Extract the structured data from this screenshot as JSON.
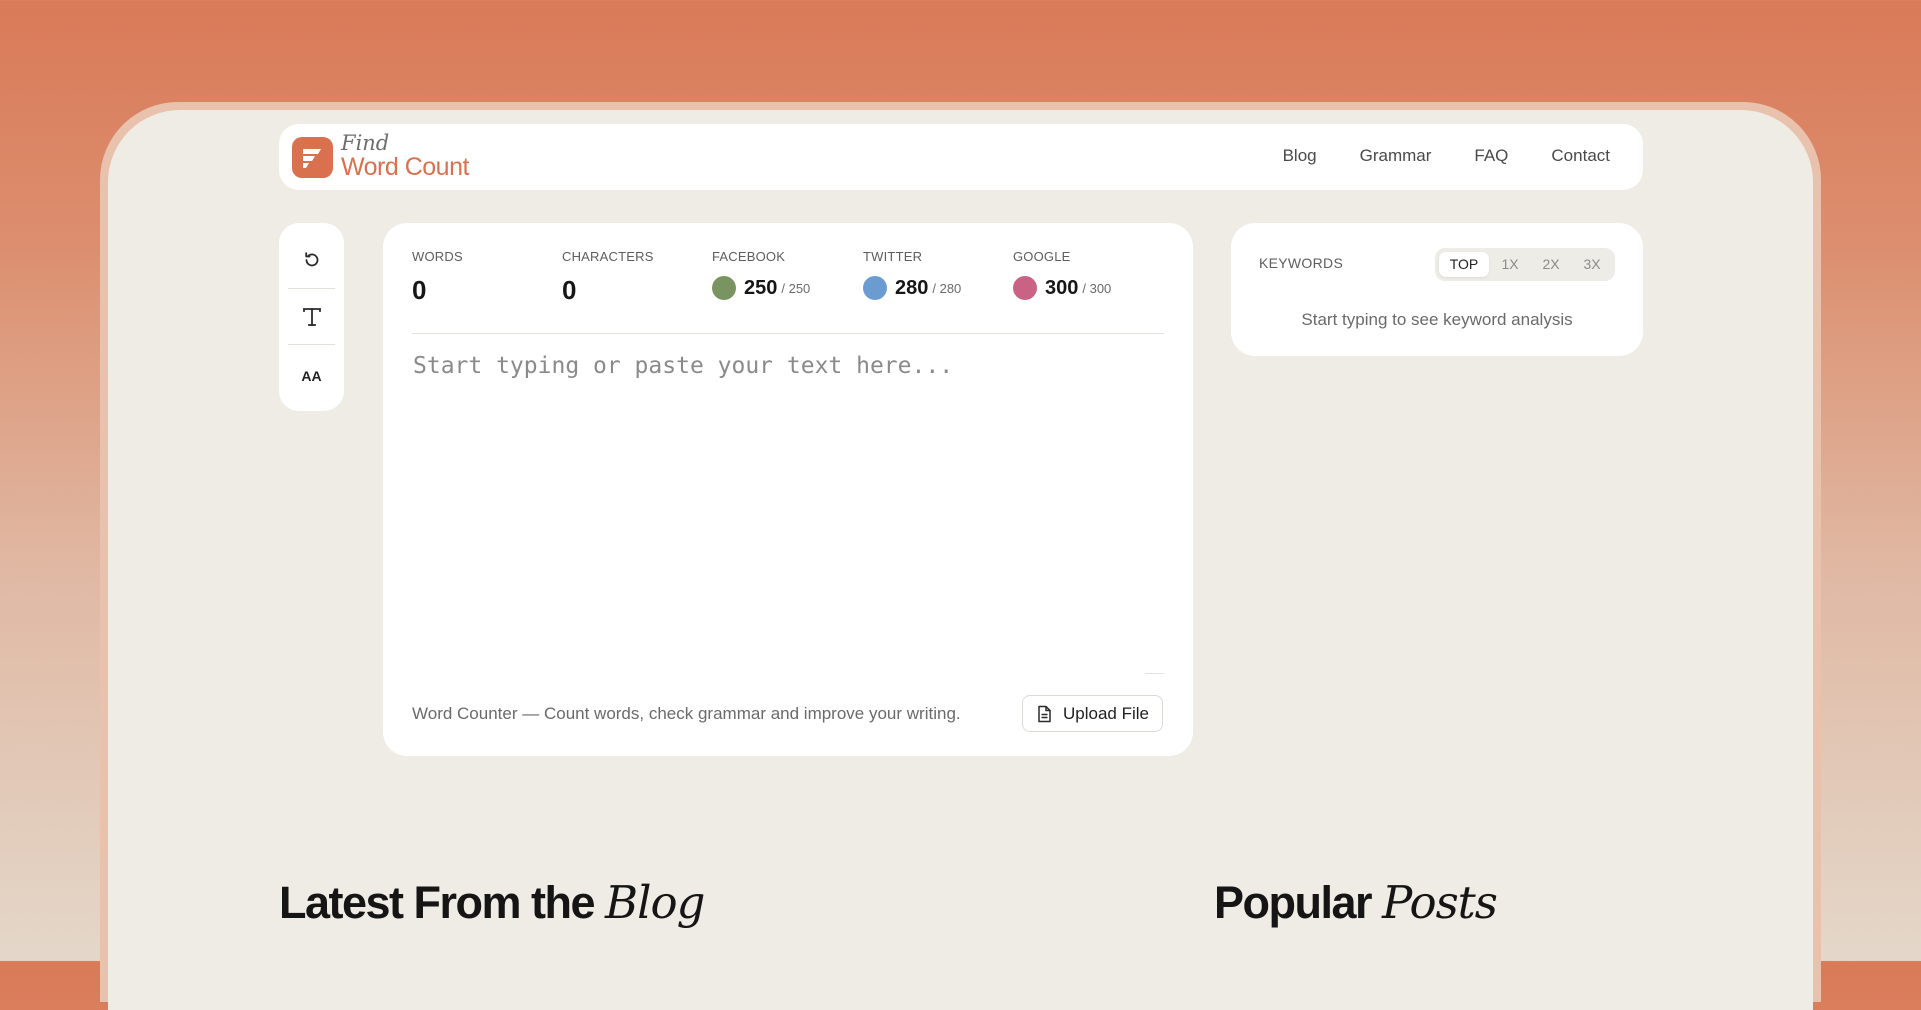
{
  "brand": {
    "logo_top": "Find",
    "logo_bottom": "Word Count",
    "accent_color": "#d9714f"
  },
  "nav": {
    "links": [
      "Blog",
      "Grammar",
      "FAQ",
      "Contact"
    ]
  },
  "toolbar": {
    "icons": [
      "reset-icon",
      "text-format-icon",
      "font-size-icon"
    ],
    "font_size_glyph": "AA"
  },
  "stats": {
    "words": {
      "label": "WORDS",
      "value": "0"
    },
    "characters": {
      "label": "CHARACTERS",
      "value": "0"
    },
    "facebook": {
      "label": "FACEBOOK",
      "value": "250",
      "max": "/ 250",
      "color": "#7a9461"
    },
    "twitter": {
      "label": "TWITTER",
      "value": "280",
      "max": "/ 280",
      "color": "#6a9bd1"
    },
    "google": {
      "label": "GOOGLE",
      "value": "300",
      "max": "/ 300",
      "color": "#c96285"
    }
  },
  "editor": {
    "placeholder": "Start typing or paste your text here...",
    "value": "",
    "footer_text": "Word Counter — Count words, check grammar and improve your writing.",
    "upload_label": "Upload File"
  },
  "keywords": {
    "title": "KEYWORDS",
    "tabs": [
      "TOP",
      "1X",
      "2X",
      "3X"
    ],
    "active_tab": "TOP",
    "empty_message": "Start typing to see keyword analysis"
  },
  "sections": {
    "blog_title_plain": "Latest From the ",
    "blog_title_italic": "Blog",
    "popular_title_plain": "Popular ",
    "popular_title_italic": "Posts"
  }
}
